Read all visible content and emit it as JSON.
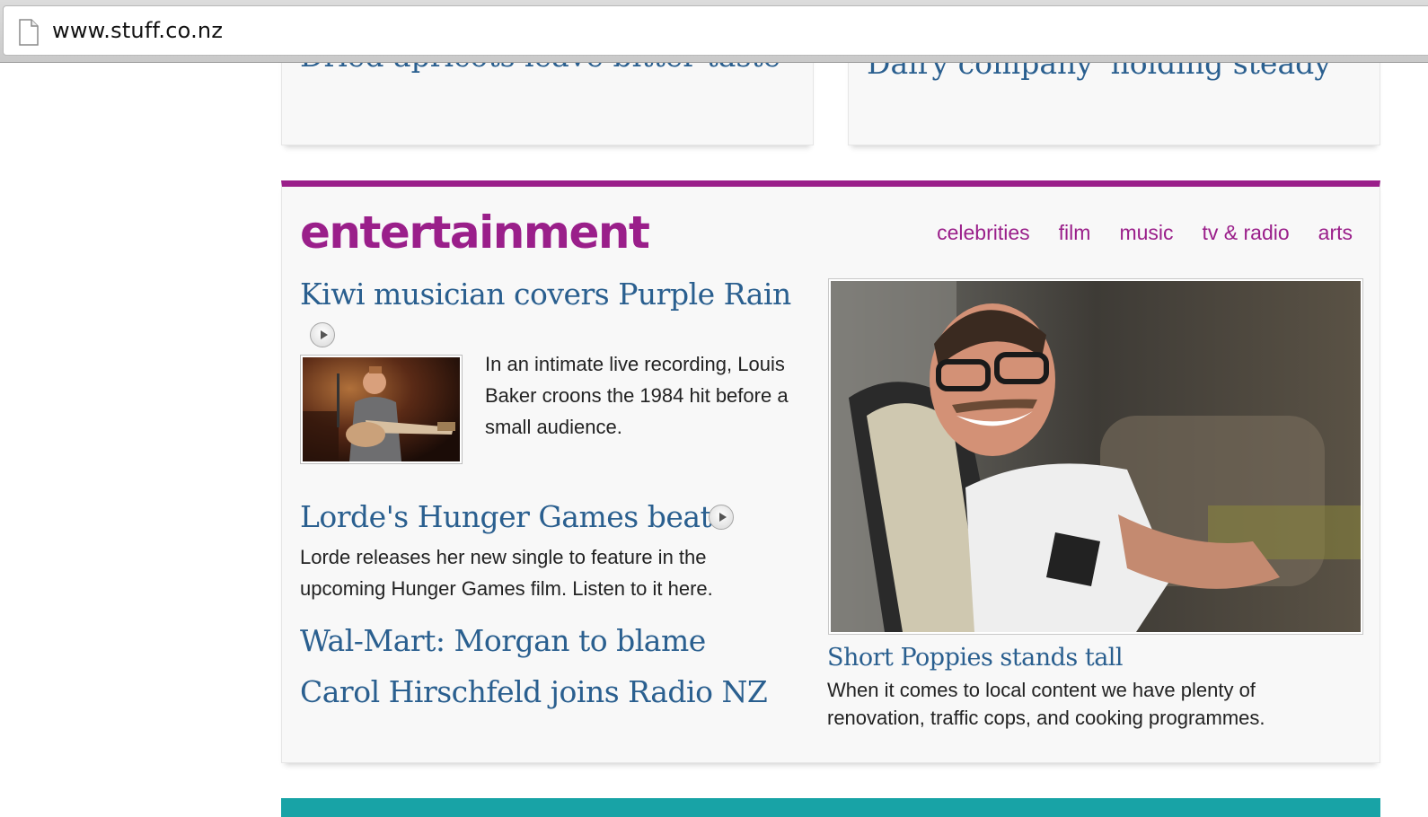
{
  "browser": {
    "url": "www.stuff.co.nz",
    "page_icon": "document-icon"
  },
  "top_cards": {
    "left_headline": "Dried apricots leave bitter taste",
    "right_headline": "Dairy company 'holding steady'"
  },
  "entertainment": {
    "title": "entertainment",
    "accent_color": "#9a1f8a",
    "nav": [
      "celebrities",
      "film",
      "music",
      "tv & radio",
      "arts"
    ],
    "stories": [
      {
        "headline": "Kiwi musician covers Purple Rain",
        "has_video": true,
        "summary": "In an intimate live recording, Louis Baker croons the 1984 hit before a small audience."
      },
      {
        "headline": "Lorde's Hunger Games beat",
        "has_video": true,
        "summary": "Lorde releases her new single to feature in the upcoming Hunger Games film. Listen to it here."
      },
      {
        "headline": "Wal-Mart: Morgan to blame"
      },
      {
        "headline": "Carol Hirschfeld joins Radio NZ"
      }
    ],
    "feature": {
      "headline": "Short Poppies stands tall",
      "summary": "When it comes to local content we have plenty of renovation, traffic cops, and cooking programmes."
    }
  },
  "next_section_color": "#18a3a6"
}
